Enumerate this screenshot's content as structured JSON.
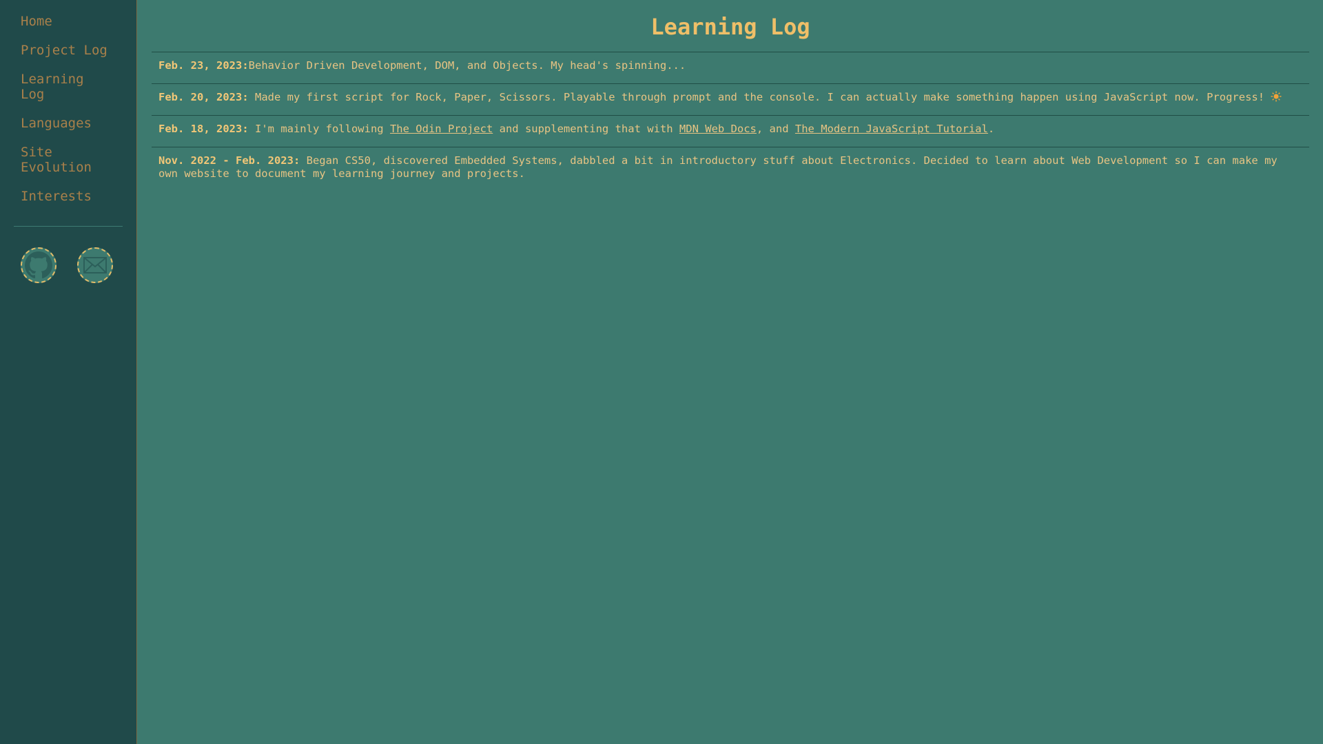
{
  "sidebar": {
    "nav": [
      {
        "label": "Home"
      },
      {
        "label": "Project Log"
      },
      {
        "label": "Learning Log"
      },
      {
        "label": "Languages"
      },
      {
        "label": "Site Evolution"
      },
      {
        "label": "Interests"
      }
    ],
    "social": [
      {
        "icon": "github-icon"
      },
      {
        "icon": "mail-icon"
      }
    ]
  },
  "main": {
    "title": "Learning Log",
    "entries": [
      {
        "date": "Feb. 23, 2023:",
        "text": "Behavior Driven Development, DOM, and Objects. My head's spinning..."
      },
      {
        "date": "Feb. 20, 2023:",
        "text": " Made my first script for Rock, Paper, Scissors. Playable through prompt and the console. I can actually make something happen using JavaScript now. Progress! ",
        "emoji": "sun-icon"
      },
      {
        "date": "Feb. 18, 2023:",
        "text_before": " I'm mainly following ",
        "link1": "The Odin Project",
        "text_mid1": " and supplementing that with ",
        "link2": "MDN Web Docs",
        "text_mid2": ", and ",
        "link3": "The Modern JavaScript Tutorial",
        "text_after": "."
      },
      {
        "date": "Nov. 2022 - Feb. 2023:",
        "text": " Began CS50, discovered Embedded Systems, dabbled a bit in introductory stuff about Electronics. Decided to learn about Web Development so I can make my own website to document my learning journey and projects."
      }
    ]
  },
  "colors": {
    "main_bg": "#3d7a6f",
    "sidebar_bg": "#204a4a",
    "nav_text": "#a9804a",
    "accent": "#efbf68"
  }
}
